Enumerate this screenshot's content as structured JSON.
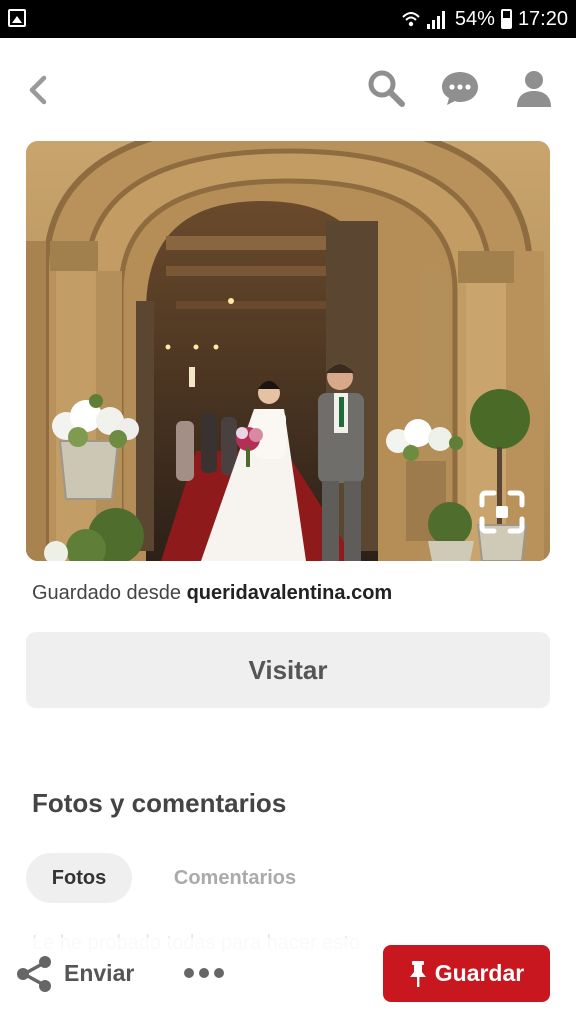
{
  "status_bar": {
    "battery": "54%",
    "time": "17:20",
    "left_icon": "image-icon",
    "icons": [
      "wifi-icon",
      "signal-icon",
      "battery-icon"
    ]
  },
  "nav": {
    "back_icon": "chevron-left-icon",
    "search_icon": "search-icon",
    "messages_icon": "chat-bubble-icon",
    "profile_icon": "person-icon"
  },
  "pin": {
    "image_description_icon": "visual-search-icon",
    "saved_from_prefix": "Guardado desde",
    "saved_from_domain": "queridavalentina.com",
    "visit_label": "Visitar"
  },
  "photos_section": {
    "title": "Fotos y comentarios",
    "tabs": [
      {
        "label": "Fotos",
        "selected": true
      },
      {
        "label": "Comentarios",
        "selected": false
      }
    ],
    "faded_text": "Le he probado todas para hacer esto"
  },
  "bottom_bar": {
    "share_label": "Enviar",
    "more_icon": "more-dots-icon",
    "save_label": "Guardar",
    "save_color": "#c8171f"
  }
}
